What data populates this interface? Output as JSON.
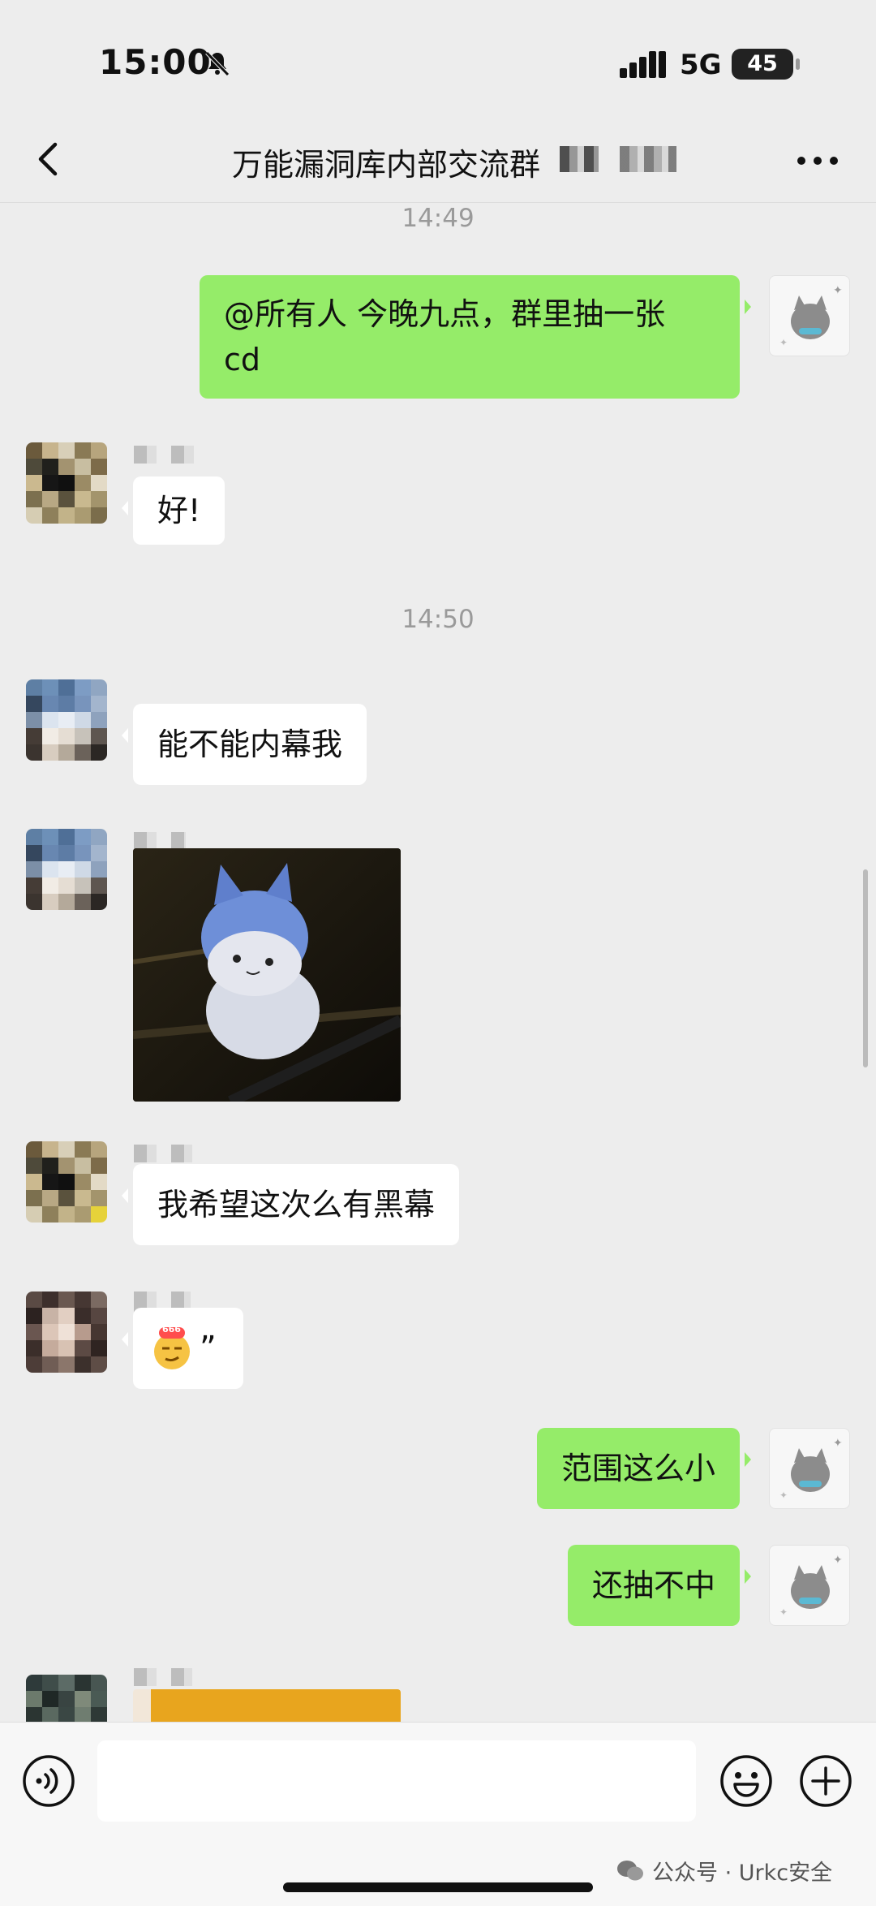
{
  "status_bar": {
    "time": "15:00",
    "network": "5G",
    "battery": "45"
  },
  "header": {
    "title": "万能漏洞库内部交流群"
  },
  "chat": {
    "timestamps": [
      "14:49",
      "14:50"
    ],
    "messages": [
      {
        "side": "out",
        "type": "text",
        "text": "@所有人 今晚九点，群里抽一张",
        "text_line2": "cd"
      },
      {
        "side": "in",
        "type": "text",
        "text": "好!"
      },
      {
        "side": "in",
        "type": "text",
        "text": "能不能内幕我"
      },
      {
        "side": "in",
        "type": "image",
        "icon": "plush-toy-photo"
      },
      {
        "side": "in",
        "type": "text",
        "text": "我希望这次么有黑幕"
      },
      {
        "side": "in",
        "type": "emoji",
        "emoji_badge": "666",
        "text": "”"
      },
      {
        "side": "out",
        "type": "text",
        "text": "范围这么小"
      },
      {
        "side": "out",
        "type": "text",
        "text": "还抽不中"
      },
      {
        "side": "in",
        "type": "image",
        "icon": "partial-image"
      }
    ]
  },
  "input_bar": {
    "placeholder": ""
  },
  "watermark": {
    "text": "公众号 · Urkc安全"
  },
  "colors": {
    "background": "#ededed",
    "outgoing_bubble": "#95ec69",
    "incoming_bubble": "#ffffff",
    "timestamp": "#9a9a9a"
  }
}
